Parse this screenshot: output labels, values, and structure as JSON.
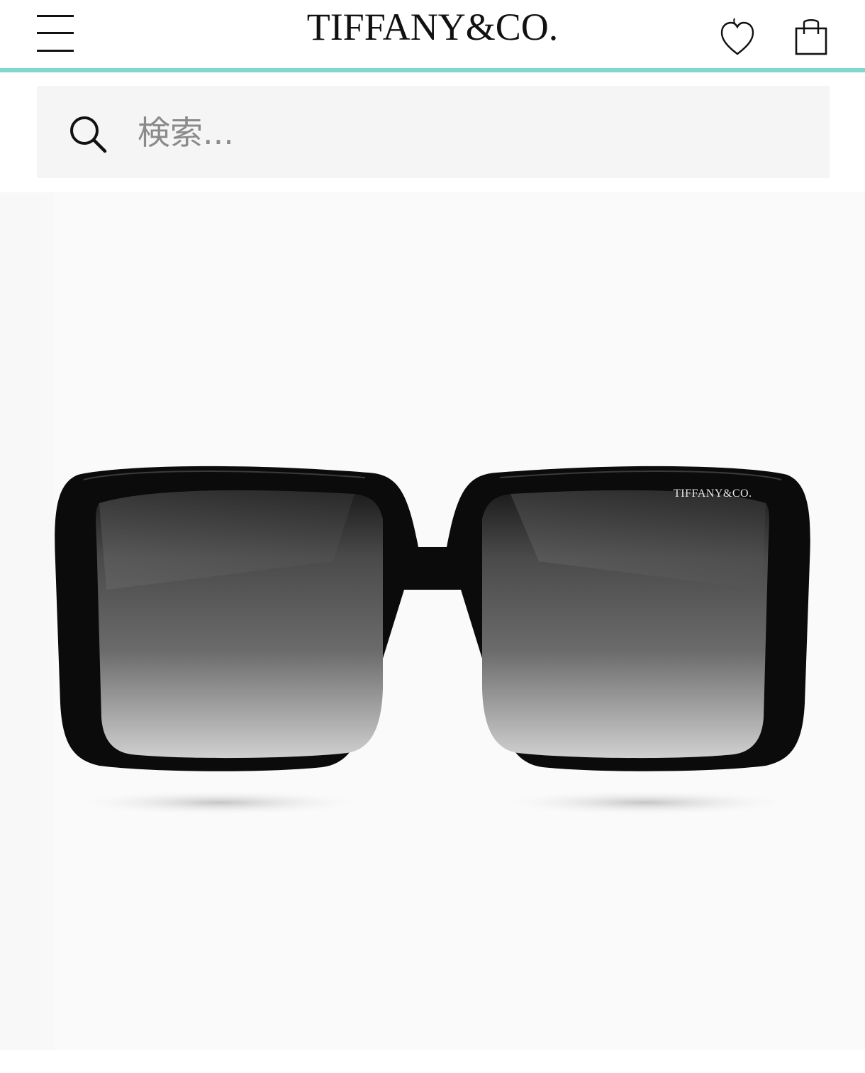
{
  "header": {
    "logo_text": "TIFFANY&CO.",
    "menu_icon": "hamburger-menu-icon",
    "wishlist_icon": "heart-icon",
    "bag_icon": "shopping-bag-icon",
    "accent_color": "#81d8d0"
  },
  "search": {
    "placeholder": "検索...",
    "icon": "search-icon"
  },
  "product_image": {
    "lens_logo_text": "TIFFANY&CO."
  }
}
